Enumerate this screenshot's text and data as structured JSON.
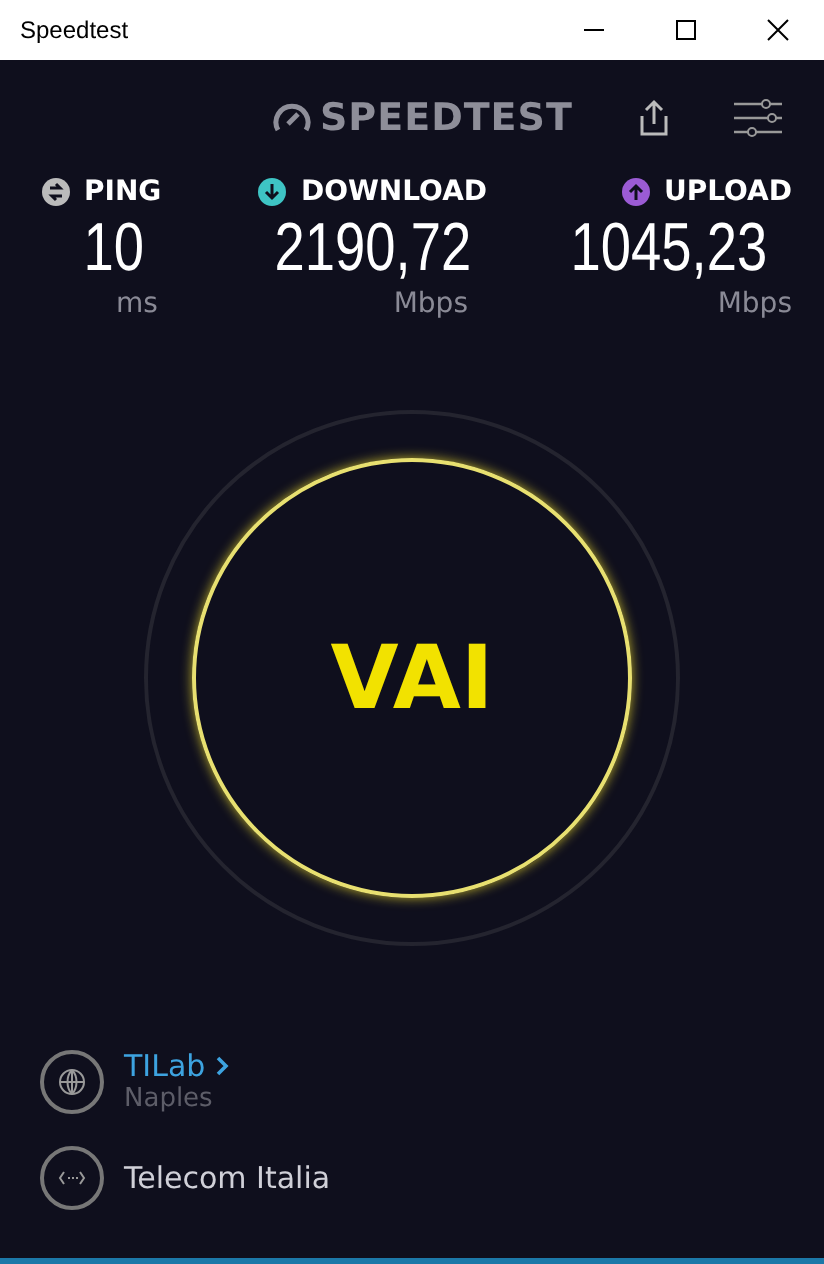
{
  "window": {
    "title": "Speedtest"
  },
  "logo": "SPEEDTEST",
  "metrics": [
    {
      "kind": "ping",
      "label": "PING",
      "value": "10",
      "unit": "ms"
    },
    {
      "kind": "download",
      "label": "DOWNLOAD",
      "value": "2190,72",
      "unit": "Mbps"
    },
    {
      "kind": "upload",
      "label": "UPLOAD",
      "value": "1045,23",
      "unit": "Mbps"
    }
  ],
  "go_button": "VAI",
  "server": {
    "name": "TILab",
    "location": "Naples"
  },
  "provider": "Telecom Italia"
}
